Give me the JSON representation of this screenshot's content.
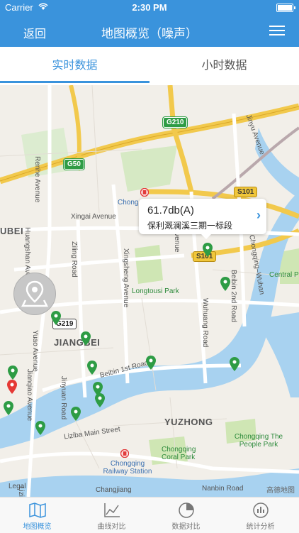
{
  "status_bar": {
    "carrier": "Carrier",
    "time": "2:30 PM"
  },
  "nav": {
    "back_label": "返回",
    "title": "地图概览（噪声）",
    "menu_icon": "hamburger-menu-icon"
  },
  "tabs": [
    {
      "label": "实时数据",
      "active": true
    },
    {
      "label": "小时数据",
      "active": false
    }
  ],
  "map": {
    "popup": {
      "value": "61.7db(A)",
      "site": "保利溉澜溪三期一标段"
    },
    "district_labels": [
      "JIANGBEI",
      "YUZHONG",
      "UBEI"
    ],
    "road_labels": [
      "Renhe Avenue",
      "Xingai Avenue",
      "Ziling Road",
      "Yuao Avenue",
      "Jianqiao Avenue",
      "Jinyuan Road",
      "Xingsheng Avenue",
      "Wuhuang Road",
      "Yulu Avenue",
      "Beibin 1st Road",
      "Beibin 2nd Road",
      "Huangshan Avenue",
      "Jinyu Avenue",
      "Liziba Main Street",
      "Nanbin Road",
      "Changjiang",
      "Chongqing–Wuhan"
    ],
    "poi_labels": [
      "Chongqing Railway Station",
      "Chongqing Coral Park",
      "Chongqing The People Park",
      "Longtousi Park",
      "Central Pa"
    ],
    "shields": [
      "G210",
      "G50",
      "S101",
      "S101",
      "G219"
    ],
    "partial_labels": [
      "Chong Railw",
      "Legal",
      "Liziba Tu"
    ],
    "brand": "高德地图",
    "legal": "Legal",
    "alert_marker_color": "#e53935",
    "station_marker_color": "#2e9c45"
  },
  "tab_bar": [
    {
      "label": "地图概览",
      "icon": "map-icon",
      "active": true
    },
    {
      "label": "曲线对比",
      "icon": "line-chart-icon",
      "active": false
    },
    {
      "label": "数据对比",
      "icon": "pie-chart-icon",
      "active": false
    },
    {
      "label": "统计分析",
      "icon": "bar-chart-icon",
      "active": false
    }
  ],
  "colors": {
    "accent": "#3a93dc",
    "river": "#a8d2f0",
    "park": "#cfe6b4",
    "expressway": "#f2c94c"
  }
}
